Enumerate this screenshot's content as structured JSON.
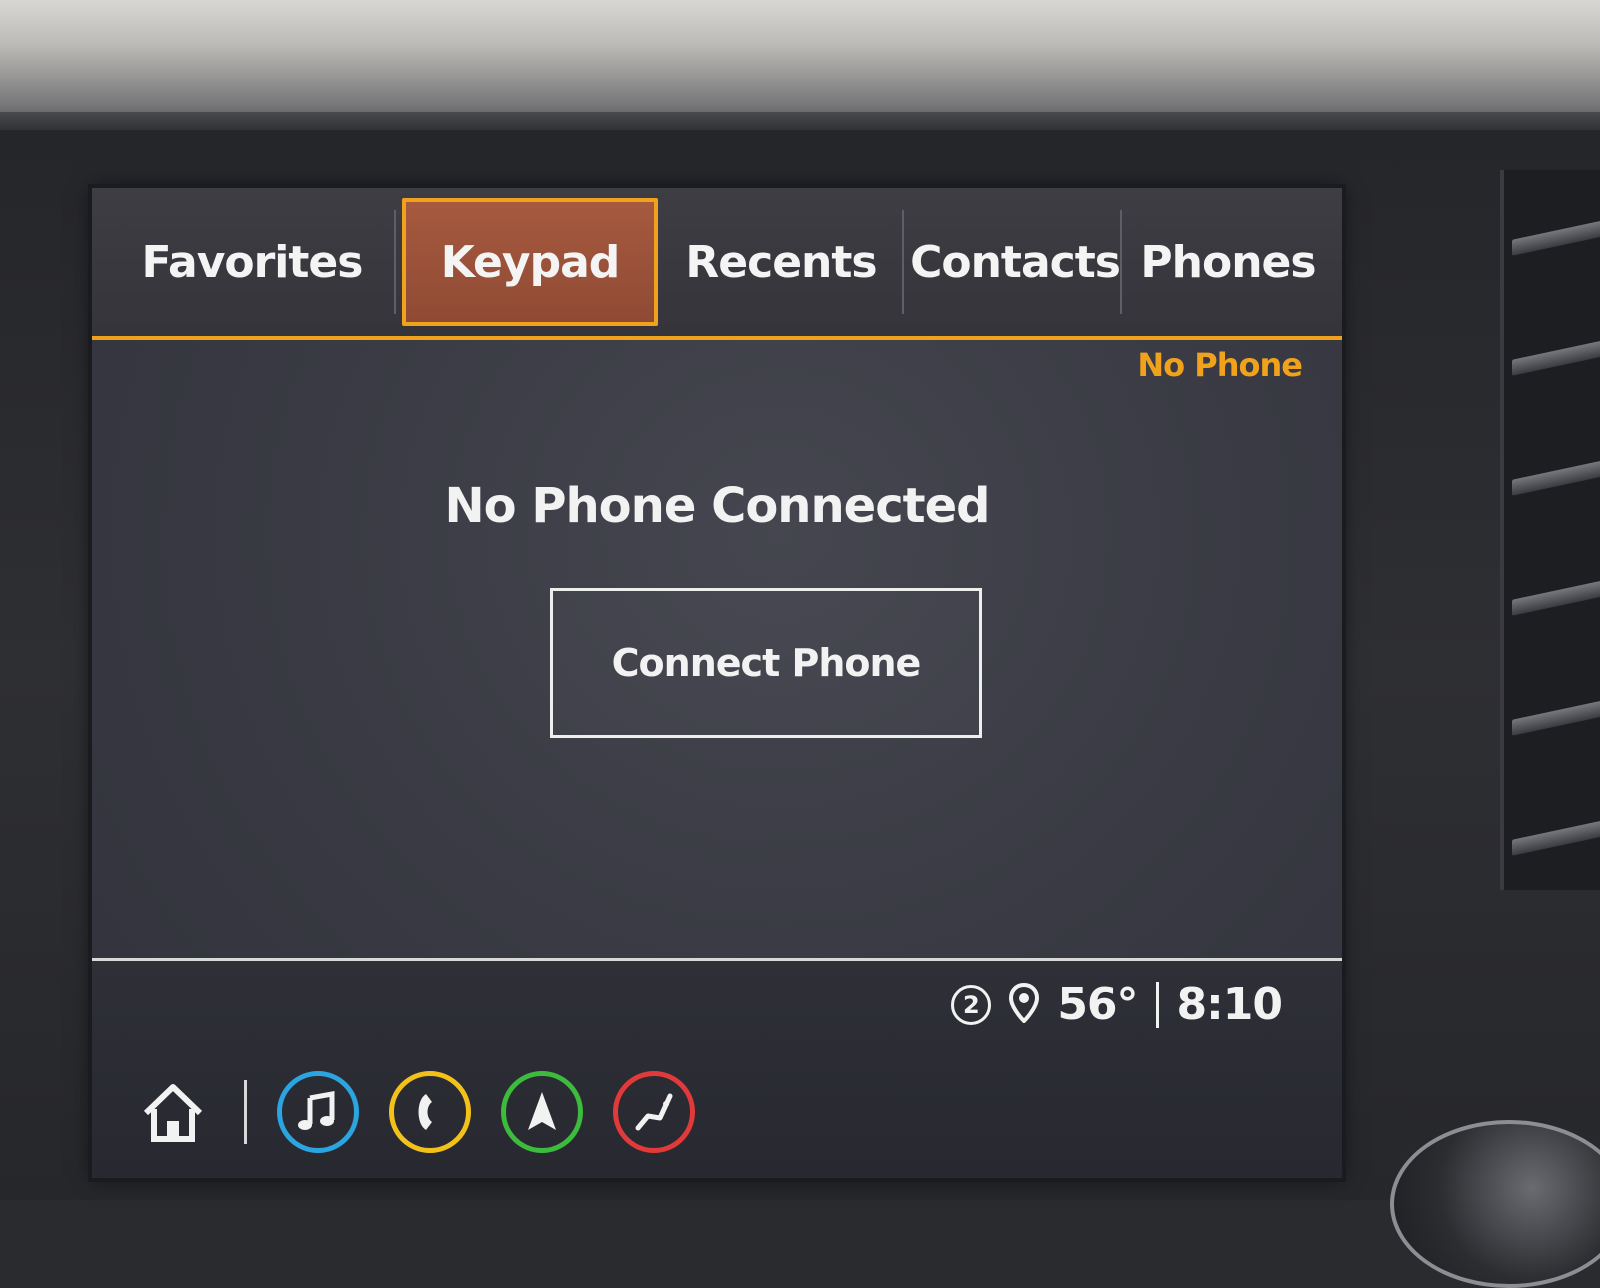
{
  "tabs": [
    {
      "label": "Favorites",
      "active": false
    },
    {
      "label": "Keypad",
      "active": true
    },
    {
      "label": "Recents",
      "active": false
    },
    {
      "label": "Contacts",
      "active": false
    },
    {
      "label": "Phones",
      "active": false
    }
  ],
  "phone_status": "No Phone",
  "message": "No Phone Connected",
  "connect_button_label": "Connect Phone",
  "status_bar": {
    "notification_count": "2",
    "temperature": "56°",
    "time": "8:10"
  },
  "app_shortcuts": [
    {
      "name": "home",
      "icon": "home-icon",
      "color": "#ffffff"
    },
    {
      "name": "audio",
      "icon": "music-note-icon",
      "color": "#2aa5e0"
    },
    {
      "name": "phone",
      "icon": "phone-icon",
      "color": "#f2c21b"
    },
    {
      "name": "navigation",
      "icon": "navigation-arrow-icon",
      "color": "#3dbb3d"
    },
    {
      "name": "climate",
      "icon": "seat-climate-icon",
      "color": "#e23a3a"
    }
  ],
  "colors": {
    "accent": "#f0a21d",
    "active_tab": "#9a5139",
    "screen_bg": "#3a3b44",
    "text": "#f2f2f2"
  }
}
